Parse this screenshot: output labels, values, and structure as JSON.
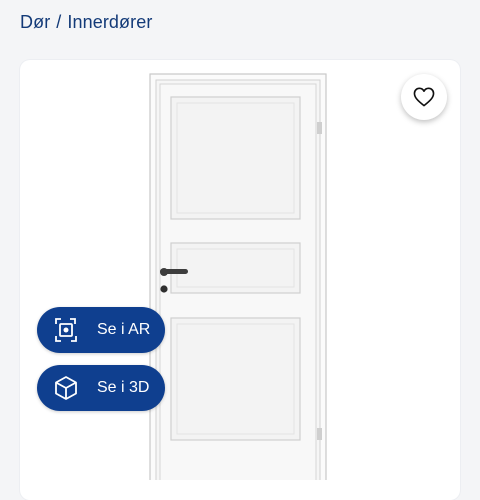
{
  "breadcrumb": {
    "items": [
      "Dør",
      "Innerdører"
    ],
    "separator": "/"
  },
  "product": {
    "image": "white-panel-interior-door",
    "favorite_icon": "heart-icon"
  },
  "actions": {
    "ar_label": "Se i AR",
    "ar_icon": "ar-cube-icon",
    "view3d_label": "Se i 3D",
    "view3d_icon": "3d-cube-icon"
  },
  "colors": {
    "brand": "#0f3f8f",
    "text": "#133a78"
  }
}
